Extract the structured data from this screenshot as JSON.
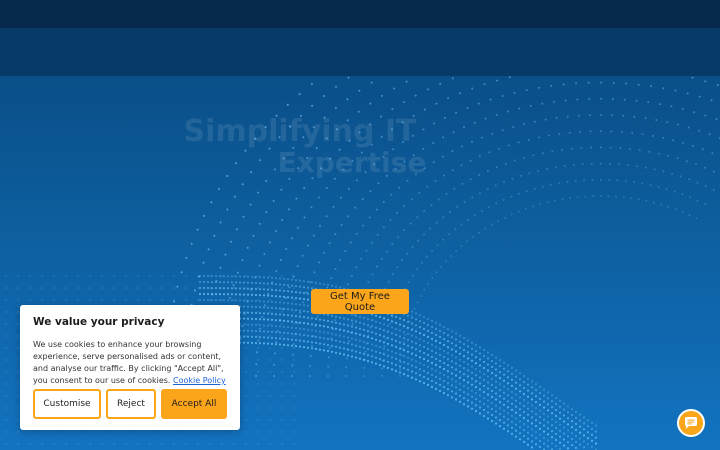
{
  "hero": {
    "title_line1": "Simplifying IT",
    "title_line2": "Expertise",
    "cta_label": "Get My Free Quote"
  },
  "cookie_banner": {
    "title": "We value your privacy",
    "body": "We use cookies to enhance your browsing experience, serve personalised ads or content, and analyse our traffic. By clicking \"Accept All\", you consent to our use of cookies.",
    "policy_link": "Cookie Policy",
    "buttons": {
      "customise": "Customise",
      "reject": "Reject",
      "accept": "Accept All"
    }
  },
  "chat_widget": {
    "icon": "chat-bubble-icon"
  },
  "colors": {
    "accent": "#fba51a",
    "header_dark": "#06284a",
    "nav_band": "#073a66",
    "hero_blue": "#1373c0",
    "link": "#1863dc"
  }
}
